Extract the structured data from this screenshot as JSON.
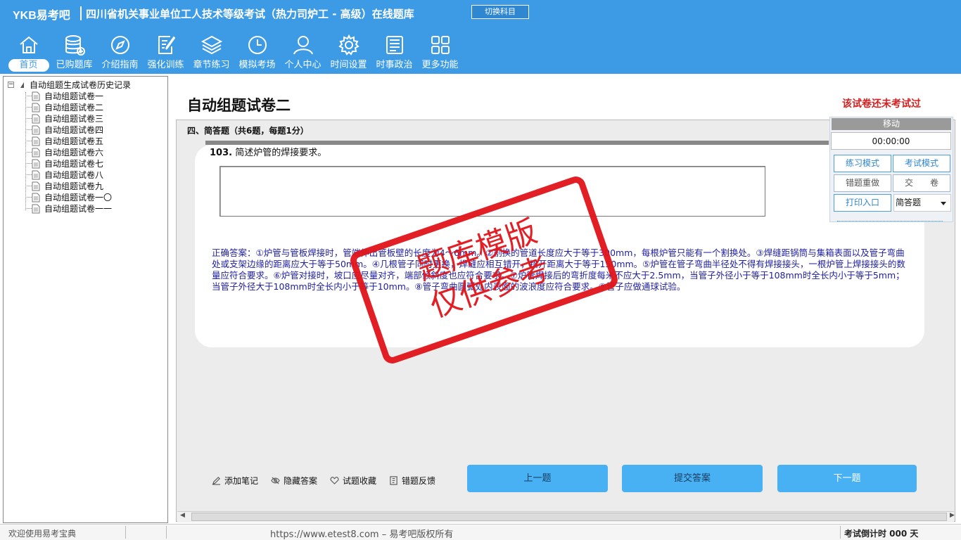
{
  "header": {
    "logo": "YKB易考吧",
    "title": "四川省机关事业单位工人技术等级考试（热力司炉工 - 高级）在线题库",
    "switch_button": "切换科目",
    "nav": [
      {
        "label": "首页",
        "icon": "home-icon"
      },
      {
        "label": "已购题库",
        "icon": "database-icon"
      },
      {
        "label": "介绍指南",
        "icon": "compass-icon"
      },
      {
        "label": "强化训练",
        "icon": "edit-icon"
      },
      {
        "label": "章节练习",
        "icon": "layers-icon"
      },
      {
        "label": "模拟考场",
        "icon": "clock-icon"
      },
      {
        "label": "个人中心",
        "icon": "user-icon"
      },
      {
        "label": "时间设置",
        "icon": "gear-icon"
      },
      {
        "label": "时事政治",
        "icon": "news-icon"
      },
      {
        "label": "更多功能",
        "icon": "grid-icon"
      }
    ]
  },
  "sidebar": {
    "root": "自动组题生成试卷历史记录",
    "items": [
      "自动组题试卷一",
      "自动组题试卷二",
      "自动组题试卷三",
      "自动组题试卷四",
      "自动组题试卷五",
      "自动组题试卷六",
      "自动组题试卷七",
      "自动组题试卷八",
      "自动组题试卷九",
      "自动组题试卷一〇",
      "自动组题试卷一一"
    ]
  },
  "main": {
    "paper_title": "自动组题试卷二",
    "status": "该试卷还未考试过",
    "section": "四、简答题（共6题，每题1分）",
    "question_number": "103.",
    "question_text": "简述炉管的焊接要求。",
    "answer": "正确答案：①炉管与管板焊接时，管端伸出管板壁的长度为4～6mm。②割换的管道长度应大于等于300mm，每根炉管只能有一个割换处。③焊缝距锅筒与集箱表面以及管子弯曲处或支架边缘的距离应大于等于50mm。④几根管子同时更换，焊缝应相互错开，错开距离大于等于150mm。⑤炉管在管子弯曲半径处不得有焊接接头，一根炉管上焊接接头的数量应符合要求。⑥炉管对接时，坡口应尽量对齐，端部倾斜度也应符合要求。⑦炉管焊接后的弯折度每米不应大于2.5mm，当管子外径小于等于108mm时全长内小于等于5mm；当管子外径大于108mm时全长内小于等于10mm。⑧管子弯曲圆弧处内表面的波浪度应符合要求。⑨管子应做通球试验。",
    "stamp_line1": "题库模版",
    "stamp_line2": "仅供参考"
  },
  "panel": {
    "move": "移动",
    "timer": "00:00:00",
    "practice_mode": "练习模式",
    "exam_mode": "考试模式",
    "redo_wrong": "错题重做",
    "submit_paper": "交　　卷",
    "print": "打印入口",
    "question_type": "简答题"
  },
  "tools": {
    "add_note": "添加笔记",
    "hide_answer": "隐藏答案",
    "favorite": "试题收藏",
    "feedback": "错题反馈"
  },
  "buttons": {
    "prev": "上一题",
    "submit": "提交答案",
    "next": "下一题"
  },
  "footer": {
    "welcome": "欢迎使用易考宝典",
    "url": "https://www.etest8.com – 易考吧版权所有",
    "countdown": "考试倒计时 000 天"
  }
}
